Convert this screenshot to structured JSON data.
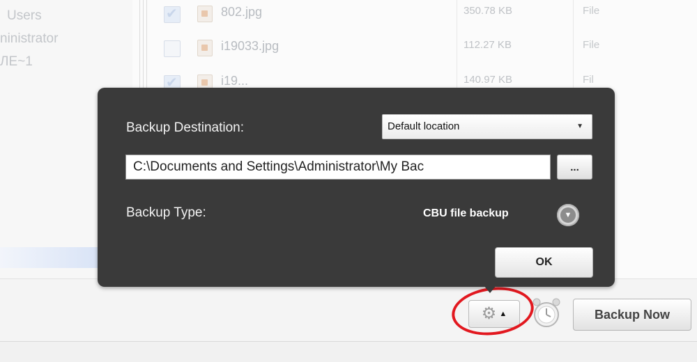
{
  "tree": {
    "items": [
      "Users",
      "ninistrator",
      "ЛЕ~1"
    ]
  },
  "files": [
    {
      "name": "802.jpg",
      "size": "350.78 KB",
      "type": "File",
      "checked": true
    },
    {
      "name": "i19033.jpg",
      "size": "112.27 KB",
      "type": "File",
      "checked": false
    },
    {
      "name": "i19...",
      "size": "140.97 KB",
      "type": "Fil",
      "checked": true
    }
  ],
  "popup": {
    "destination_label": "Backup Destination:",
    "destination_selected": "Default location",
    "path_value": "C:\\Documents and Settings\\Administrator\\My Bac",
    "browse_label": "...",
    "type_label": "Backup Type:",
    "type_value": "CBU file backup",
    "ok_label": "OK"
  },
  "toolbar": {
    "settings_icon": "gear-icon",
    "schedule_icon": "alarm-clock-icon",
    "backup_now_label": "Backup Now"
  },
  "colors": {
    "popup_bg": "#3a3a3a",
    "highlight_ring": "#e2181f"
  }
}
